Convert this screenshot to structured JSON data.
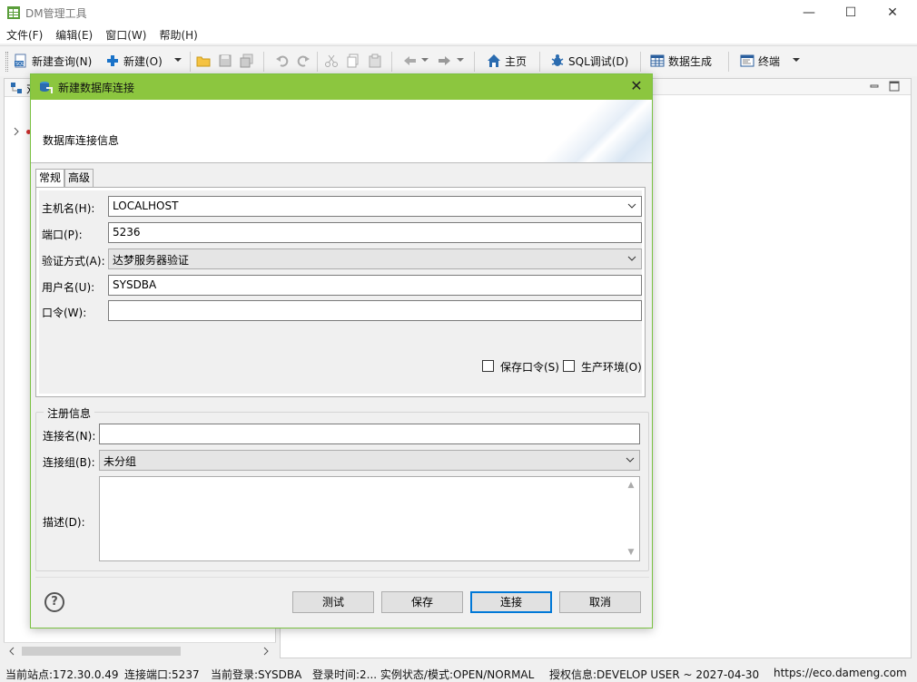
{
  "window": {
    "title": "DM管理工具",
    "minimize": "—",
    "maximize": "☐",
    "close": "✕"
  },
  "menubar": {
    "items": [
      "文件(F)",
      "编辑(E)",
      "窗口(W)",
      "帮助(H)"
    ]
  },
  "toolbar": {
    "new_query": "新建查询(N)",
    "new": "新建(O)",
    "home": "主页",
    "sql_debug": "SQL调试(D)",
    "data_gen": "数据生成",
    "terminal": "终端"
  },
  "leftpane": {
    "tab_label": "对"
  },
  "dialog": {
    "title": "新建数据库连接",
    "banner_text": "数据库连接信息",
    "tabs": [
      "常规",
      "高级"
    ],
    "general": {
      "host_label": "主机名(H):",
      "host_value": "LOCALHOST",
      "port_label": "端口(P):",
      "port_value": "5236",
      "auth_label": "验证方式(A):",
      "auth_value": "达梦服务器验证",
      "user_label": "用户名(U):",
      "user_value": "SYSDBA",
      "password_label": "口令(W):",
      "password_value": "",
      "save_password": "保存口令(S)",
      "production_env": "生产环境(O)"
    },
    "registration": {
      "group_title": "注册信息",
      "conn_name_label": "连接名(N):",
      "conn_name_value": "",
      "conn_group_label": "连接组(B):",
      "conn_group_value": "未分组",
      "description_label": "描述(D):"
    },
    "buttons": {
      "help": "?",
      "test": "测试",
      "save": "保存",
      "connect": "连接",
      "cancel": "取消"
    }
  },
  "statusbar": {
    "site": "当前站点:172.30.0.49",
    "port": "连接端口:5237",
    "login": "当前登录:SYSDBA",
    "login_time": "登录时间:2... 实例状态/模式:OPEN/NORMAL",
    "license": "授权信息:DEVELOP USER ~ 2027-04-30",
    "url": "https://eco.dameng.com"
  },
  "colors": {
    "dialog_title_bg": "#8cc63f",
    "dialog_border": "#7ac142",
    "primary_button_border": "#0078d7",
    "home_icon": "#2b6cb0",
    "new_icon": "#1a73c9"
  },
  "icons": {
    "app": "database-table-icon",
    "dialog": "database-connect-icon",
    "home": "house-icon",
    "sql_debug": "bug-icon",
    "data_gen": "table-grid-icon",
    "terminal": "terminal-window-icon"
  }
}
